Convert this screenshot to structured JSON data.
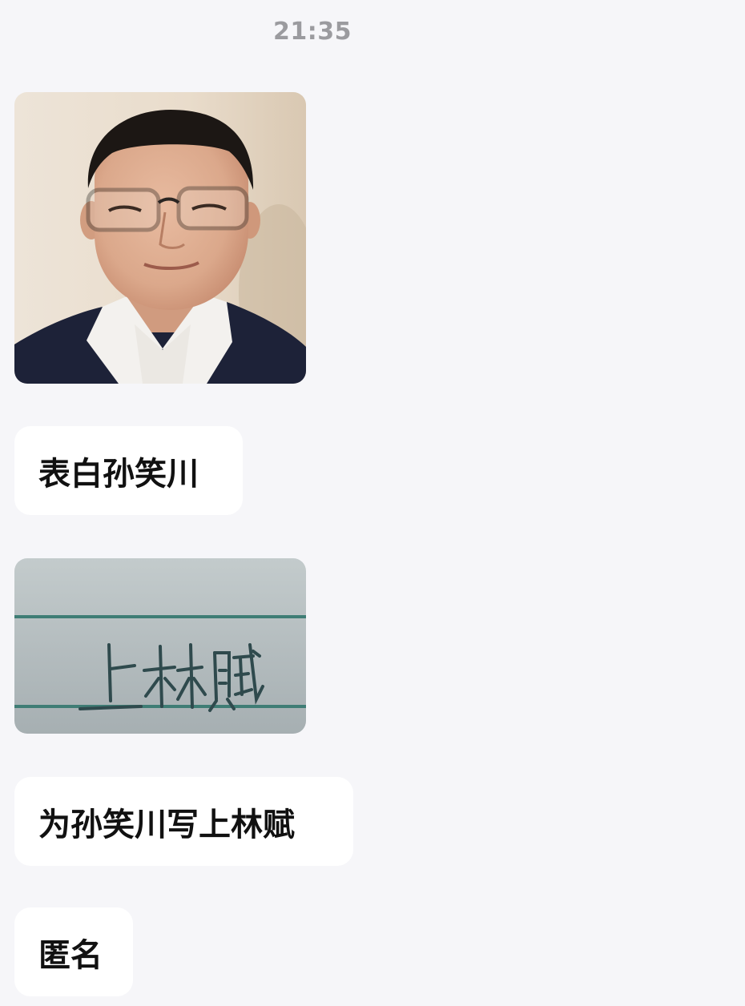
{
  "chat": {
    "timestamp": "21:35",
    "messages": [
      {
        "type": "image",
        "content": "portrait-photo"
      },
      {
        "type": "text",
        "text": "表白孙笑川"
      },
      {
        "type": "image",
        "content": "handwriting-photo",
        "handwritten_text": "上林赋"
      },
      {
        "type": "text",
        "text": "为孙笑川写上林赋"
      },
      {
        "type": "text",
        "text": "匿名"
      }
    ]
  }
}
